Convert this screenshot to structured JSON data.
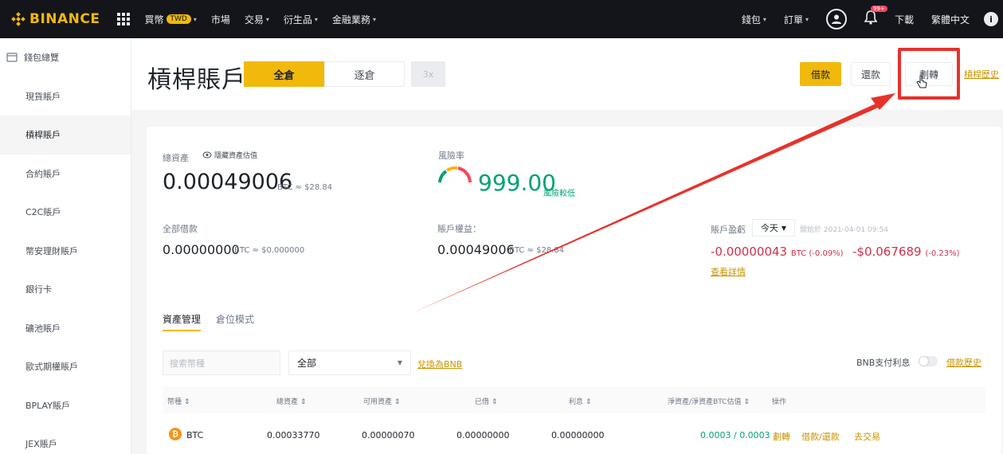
{
  "topnav": {
    "logo_text": "BINANCE",
    "items": [
      {
        "label": "買幣",
        "badge": "TWD",
        "caret": "▾"
      },
      {
        "label": "市場"
      },
      {
        "label": "交易",
        "caret": "▾"
      },
      {
        "label": "衍生品",
        "caret": "▾"
      },
      {
        "label": "金融業務",
        "caret": "▾"
      }
    ],
    "right": {
      "wallet": "錢包",
      "orders": "訂單",
      "notif_badge": "99+",
      "download": "下載",
      "language": "繁體中文",
      "info": "i",
      "caret": "▾"
    }
  },
  "sidebar": {
    "items": [
      {
        "label": "錢包總覽"
      },
      {
        "label": "現貨賬戶"
      },
      {
        "label": "槓桿賬戶",
        "active": true
      },
      {
        "label": "合約賬戶"
      },
      {
        "label": "C2C賬戶"
      },
      {
        "label": "幣安理財賬戶"
      },
      {
        "label": "銀行卡"
      },
      {
        "label": "礦池賬戶"
      },
      {
        "label": "歐式期權賬戶"
      },
      {
        "label": "BPLAY賬戶"
      },
      {
        "label": "JEX賬戶"
      }
    ]
  },
  "header": {
    "title": "槓桿賬戶",
    "tab_cross": "全倉",
    "tab_isolated": "逐倉",
    "leverage": "3x",
    "borrow": "借款",
    "repay": "還款",
    "transfer": "劃轉",
    "history": "槓桿歷史"
  },
  "summary": {
    "total_label": "總資產",
    "hide_label": "隱藏資產估值",
    "total_value": "0.00049006",
    "total_unit": "BTC ≈ $28.84",
    "risk_label": "風險率",
    "risk_value": "999.00",
    "risk_level": "風險較低",
    "debt_label": "全部借款",
    "debt_value": "0.00000000",
    "debt_unit": "BTC ≈ $0.000000",
    "equity_label": "賬戶權益：",
    "equity_value": "0.00049006",
    "equity_unit": "BTC ≈ $28.84",
    "pnl_label": "賬戶盈虧",
    "pnl_period": "今天",
    "pnl_start": "開始於 2021-04-01 09:54",
    "pnl_btc": "-0.00000043",
    "pnl_btc_unit": "BTC (-0.09%)",
    "pnl_usd": "-$0.067689",
    "pnl_usd_pct": "(-0.23%)",
    "detail_link": "查看詳情"
  },
  "subtabs": {
    "asset_mgmt": "資產管理",
    "position_mode": "倉位模式"
  },
  "filters": {
    "search_placeholder": "搜索幣種",
    "select_value": "全部",
    "convert_link": "兌換為BNB",
    "bnb_pay_label": "BNB支付利息",
    "borrow_history": "借款歷史"
  },
  "table": {
    "headers": [
      "幣種 ⇕",
      "總資產 ⇕",
      "可用資產 ⇕",
      "已借 ⇕",
      "利息 ⇕",
      "淨資產/淨資產BTC估值 ⇕",
      "操作"
    ],
    "row": {
      "coin": "BTC",
      "coin_icon": "₿",
      "total": "0.00033770",
      "available": "0.00000070",
      "borrowed": "0.00000000",
      "interest": "0.00000000",
      "net": "0.0003 / 0.0003",
      "action_transfer": "劃轉",
      "action_borrow_repay": "借款/還款",
      "action_trade": "去交易"
    }
  },
  "colors": {
    "brand": "#f0b90b",
    "nav_bg": "#14151a",
    "up": "#02a07a",
    "down": "#cf304a",
    "annotation": "#e8312b"
  }
}
